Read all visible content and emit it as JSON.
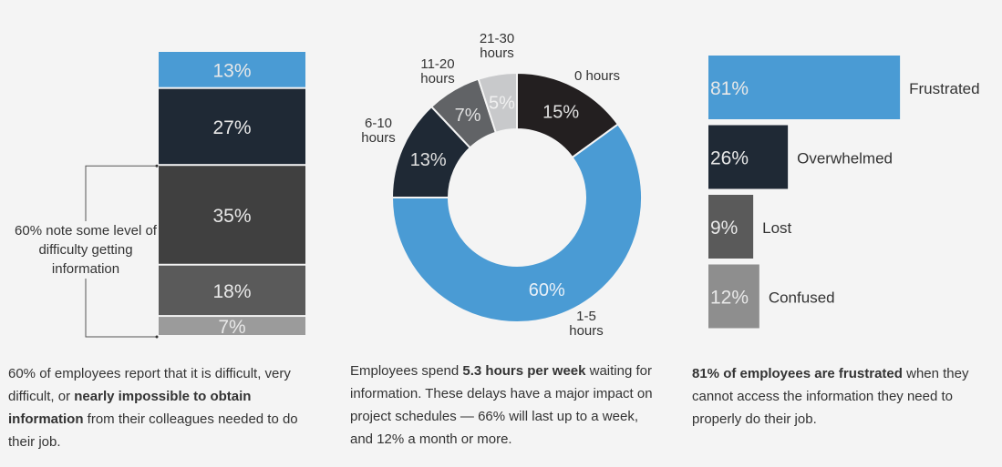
{
  "colors": {
    "background": "#f4f4f4",
    "text": "#333333",
    "blue": "#4a9bd4",
    "navy": "#1f2935",
    "charcoal": "#404040",
    "dark_gray": "#5a5a5a",
    "mid_gray": "#8e8e8e",
    "light_gray": "#9b9b9b"
  },
  "chart_data": [
    {
      "type": "bar",
      "orientation": "stacked-vertical",
      "values": [
        13,
        27,
        35,
        18,
        7
      ],
      "labels": [
        "13%",
        "27%",
        "35%",
        "18%",
        "7%"
      ],
      "colors": [
        "#4a9bd4",
        "#1f2935",
        "#404040",
        "#5a5a5a",
        "#9b9b9b"
      ],
      "annotation": "60% note some level of difficulty getting information"
    },
    {
      "type": "pie",
      "donut": true,
      "categories": [
        "0 hours",
        "1-5 hours",
        "6-10 hours",
        "11-20 hours",
        "21-30 hours"
      ],
      "category_lines": [
        [
          "0 hours"
        ],
        [
          "1-5",
          "hours"
        ],
        [
          "6-10",
          "hours"
        ],
        [
          "11-20",
          "hours"
        ],
        [
          "21-30",
          "hours"
        ]
      ],
      "values": [
        15,
        60,
        13,
        7,
        5
      ],
      "labels": [
        "15%",
        "60%",
        "13%",
        "7%",
        "5%"
      ],
      "colors": [
        "#231f20",
        "#4a9bd4",
        "#1f2935",
        "#616366",
        "#c8c9cb"
      ]
    },
    {
      "type": "bar",
      "orientation": "horizontal",
      "categories": [
        "Frustrated",
        "Overwhelmed",
        "Lost",
        "Confused"
      ],
      "values": [
        81,
        26,
        9,
        12
      ],
      "labels": [
        "81%",
        "26%",
        "9%",
        "12%"
      ],
      "colors": [
        "#4a9bd4",
        "#1f2935",
        "#5a5a5a",
        "#8e8e8e"
      ]
    }
  ],
  "captions": [
    [
      {
        "t": "60% of employees report that it is difficult, very difficult, or "
      },
      {
        "t": "nearly impossible to obtain information",
        "b": true
      },
      {
        "t": " from their colleagues needed to do their job."
      }
    ],
    [
      {
        "t": "Employees spend "
      },
      {
        "t": "5.3 hours per week",
        "b": true
      },
      {
        "t": " waiting for information. These delays have a major impact on project schedules — 66% will last up to a week, and 12% a month or more."
      }
    ],
    [
      {
        "t": "81% of employees are frustrated",
        "b": true
      },
      {
        "t": " when they cannot access the information they need to properly do their job."
      }
    ]
  ]
}
